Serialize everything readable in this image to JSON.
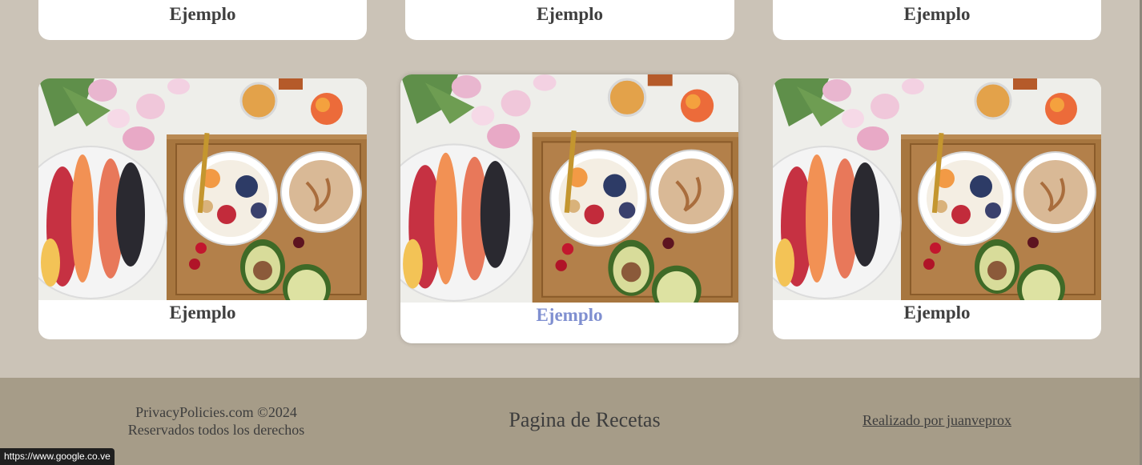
{
  "cards_top_row": [
    {
      "title": "Ejemplo"
    },
    {
      "title": "Ejemplo"
    },
    {
      "title": "Ejemplo"
    }
  ],
  "cards_bottom_row": [
    {
      "title": "Ejemplo",
      "image": "breakfast-bowl-photo"
    },
    {
      "title": "Ejemplo",
      "image": "breakfast-bowl-photo",
      "state": "hover"
    },
    {
      "title": "Ejemplo",
      "image": "breakfast-bowl-photo"
    }
  ],
  "footer": {
    "copyright": "PrivacyPolicies.com ©2024",
    "rights": "Reservados todos los derechos",
    "site_name": "Pagina de Recetas",
    "credit_link": "Realizado por juanveprox"
  },
  "status_bar": {
    "url": "https://www.google.co.ve"
  },
  "colors": {
    "background": "#cbc3b7",
    "footer": "#a69c88",
    "hover_title": "#7f8fd0"
  }
}
